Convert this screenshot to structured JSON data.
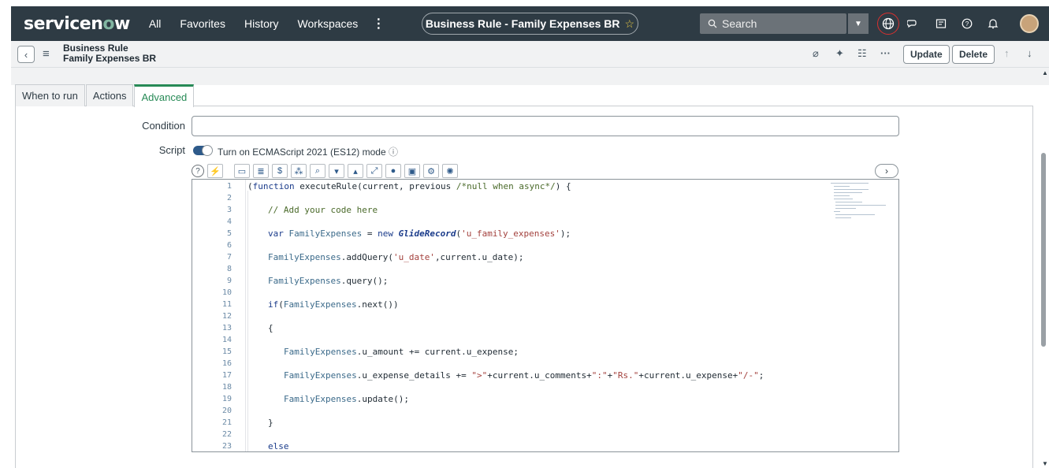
{
  "header": {
    "logo_part1": "servicen",
    "logo_o": "o",
    "logo_part2": "w",
    "nav": [
      "All",
      "Favorites",
      "History",
      "Workspaces"
    ],
    "context_title": "Business Rule - Family Expenses BR",
    "search_placeholder": "Search"
  },
  "record": {
    "type": "Business Rule",
    "name": "Family Expenses BR",
    "update_label": "Update",
    "delete_label": "Delete"
  },
  "tabs": [
    {
      "label": "When to run",
      "active": false
    },
    {
      "label": "Actions",
      "active": false
    },
    {
      "label": "Advanced",
      "active": true
    }
  ],
  "form": {
    "condition_label": "Condition",
    "condition_value": "",
    "script_label": "Script",
    "es_mode_label": "Turn on ECMAScript 2021 (ES12) mode"
  },
  "code_lines": [
    "1",
    "2",
    "3",
    "4",
    "5",
    "6",
    "7",
    "8",
    "9",
    "10",
    "11",
    "12",
    "13",
    "14",
    "15",
    "16",
    "17",
    "18",
    "19",
    "20",
    "21",
    "22",
    "23"
  ],
  "colors": {
    "nav_bg": "#2e3b44",
    "accent_green": "#278a56",
    "logo_o": "#81b5a1"
  }
}
